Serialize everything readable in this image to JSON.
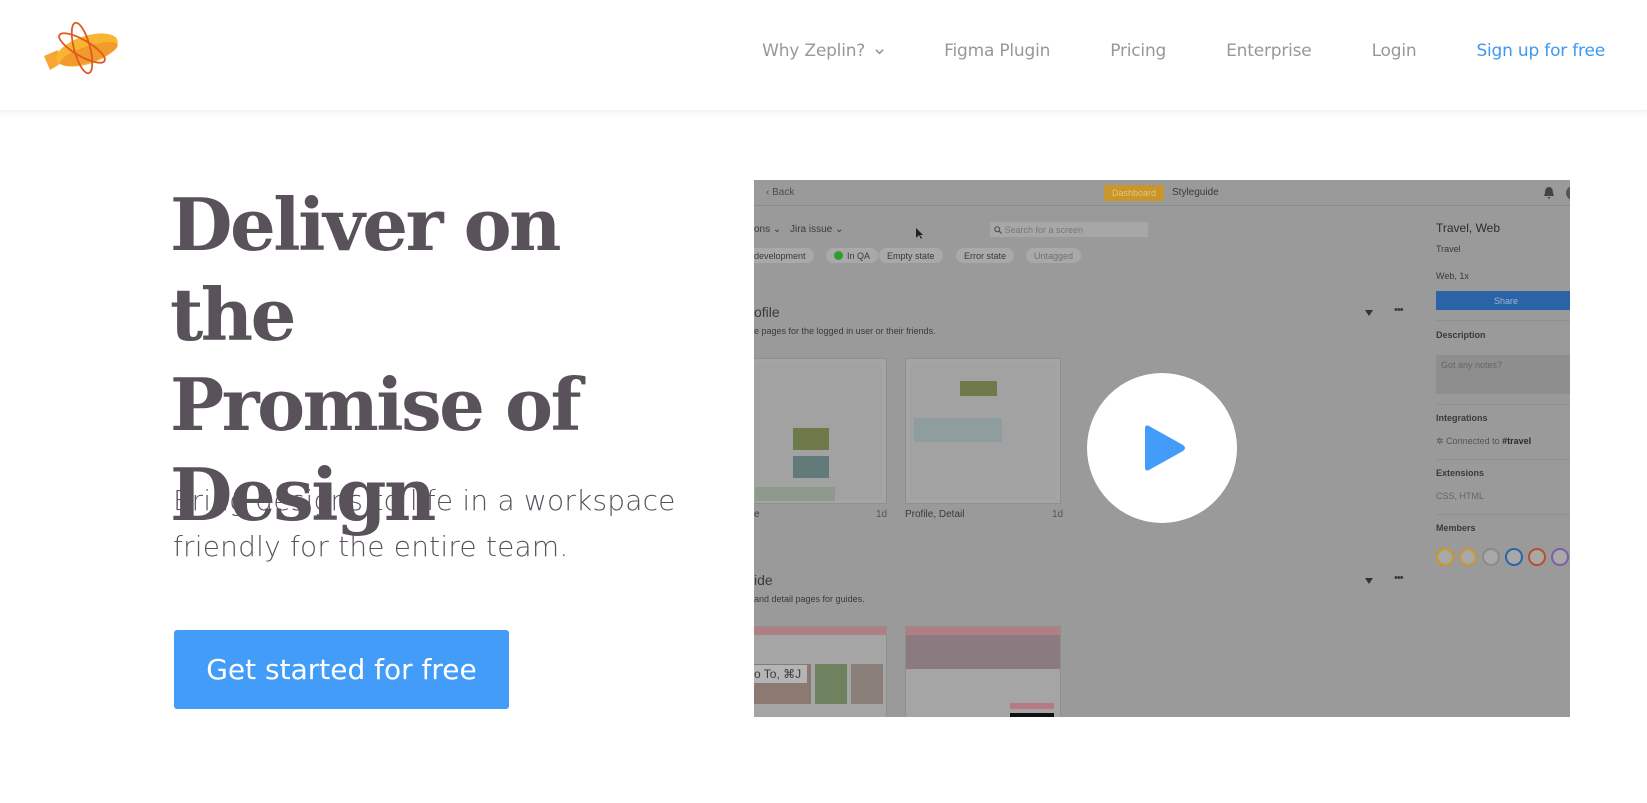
{
  "header": {
    "logo_alt": "Zeplin",
    "nav": [
      {
        "label": "Why Zeplin?",
        "has_dropdown": true
      },
      {
        "label": "Figma Plugin"
      },
      {
        "label": "Pricing"
      },
      {
        "label": "Enterprise"
      },
      {
        "label": "Login"
      },
      {
        "label": "Sign up for free",
        "accent": "#3d98f0"
      }
    ]
  },
  "hero": {
    "title_lines": [
      "Deliver on the",
      "Promise of",
      "Design"
    ],
    "subtitle_lines": [
      "Bring designs to life in a workspace",
      "friendly for the entire team."
    ],
    "cta_label": "Get started for free",
    "cta_color": "#439cf8"
  },
  "video": {
    "play_icon": "play-icon",
    "play_color": "#439cf8",
    "app": {
      "back_label": "Back",
      "tabs": [
        "Dashboard",
        "Styleguide"
      ],
      "active_tab": "Dashboard",
      "filters": [
        "ons",
        "Jira issue"
      ],
      "search_placeholder": "Search for a screen",
      "tags": [
        "development",
        "In QA",
        "Empty state",
        "Error state",
        "Untagged"
      ],
      "sections": [
        {
          "title": "ofile",
          "description": "e pages for the logged in user or their friends.",
          "screens": [
            {
              "name": "e",
              "time": "1d"
            },
            {
              "name": "Profile, Detail",
              "time": "1d"
            }
          ]
        },
        {
          "title": "ide",
          "description": "and detail pages for guides.",
          "screens": [
            {
              "name": "",
              "time": ""
            },
            {
              "name": "",
              "time": ""
            }
          ]
        }
      ],
      "shortcut_overlay": "o To, ⌘J",
      "panel": {
        "title": "Travel, Web",
        "subtitle": "Travel",
        "platform": "Web, 1x",
        "share_label": "Share",
        "description_label": "Description",
        "description_placeholder": "Got any notes?",
        "integrations_label": "Integrations",
        "integrations_text": "Connected to",
        "integrations_channel": "#travel",
        "extensions_label": "Extensions",
        "extensions_value": "CSS, HTML",
        "members_label": "Members",
        "member_colors": [
          "#c99a1e",
          "#c9962f",
          "#8a8a8a",
          "#2a64a8",
          "#b5502a",
          "#7a5ea8"
        ]
      }
    }
  }
}
